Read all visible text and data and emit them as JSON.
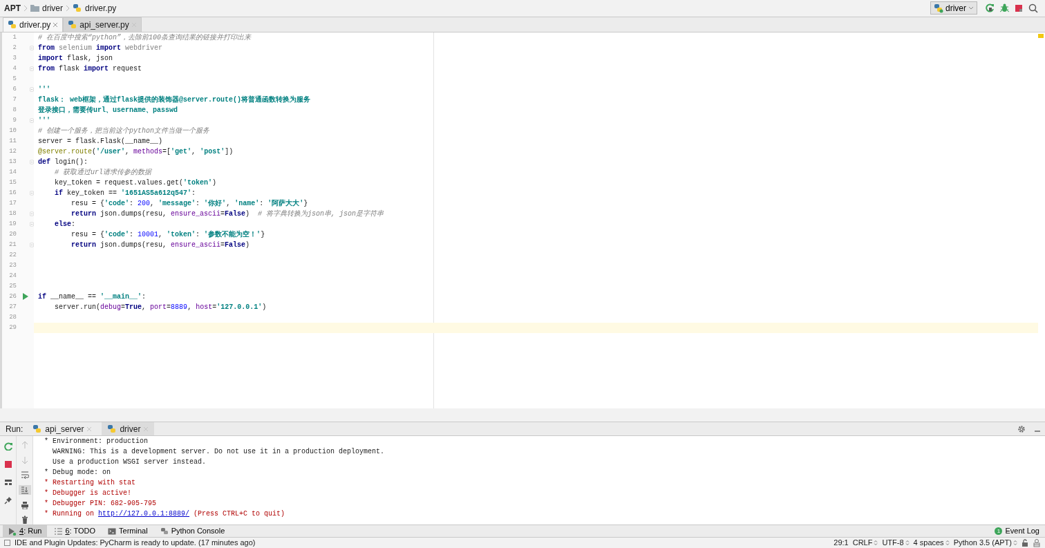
{
  "breadcrumb": [
    {
      "kind": "project",
      "label": "APT"
    },
    {
      "kind": "folder",
      "label": "driver"
    },
    {
      "kind": "file",
      "label": "driver.py"
    }
  ],
  "run_config": {
    "label": "driver"
  },
  "editor_tabs": [
    {
      "label": "driver.py",
      "selected": true
    },
    {
      "label": "api_server.py",
      "selected": false
    }
  ],
  "code_lines": [
    {
      "number": "1",
      "fold": false,
      "run": false,
      "current": false,
      "tokens": [
        {
          "kind": "comment",
          "text": "# 在百度中搜索“python”，去除前100条查询结果的链接并打印出来"
        }
      ]
    },
    {
      "number": "2",
      "fold": true,
      "run": false,
      "current": false,
      "tokens": [
        {
          "kind": "keyword",
          "text": "from"
        },
        {
          "kind": "unused",
          "text": " selenium "
        },
        {
          "kind": "keyword",
          "text": "import"
        },
        {
          "kind": "unused",
          "text": " webdriver"
        }
      ]
    },
    {
      "number": "3",
      "fold": false,
      "run": false,
      "current": false,
      "tokens": [
        {
          "kind": "keyword",
          "text": "import"
        },
        {
          "kind": "plain",
          "text": " flask, json"
        }
      ]
    },
    {
      "number": "4",
      "fold": true,
      "run": false,
      "current": false,
      "tokens": [
        {
          "kind": "keyword",
          "text": "from"
        },
        {
          "kind": "plain",
          "text": " flask "
        },
        {
          "kind": "keyword",
          "text": "import"
        },
        {
          "kind": "plain",
          "text": " request"
        }
      ]
    },
    {
      "number": "5",
      "fold": false,
      "run": false,
      "current": false
    },
    {
      "number": "6",
      "fold": true,
      "run": false,
      "current": false,
      "tokens": [
        {
          "kind": "doc",
          "text": "'''"
        }
      ]
    },
    {
      "number": "7",
      "fold": false,
      "run": false,
      "current": false,
      "tokens": [
        {
          "kind": "doc",
          "text": "flask： web框架，通过flask提供的装饰器@server.route()将普通函数转换为服务"
        }
      ]
    },
    {
      "number": "8",
      "fold": false,
      "run": false,
      "current": false,
      "tokens": [
        {
          "kind": "doc",
          "text": "登录接口，需要传url、username、passwd"
        }
      ]
    },
    {
      "number": "9",
      "fold": true,
      "run": false,
      "current": false,
      "tokens": [
        {
          "kind": "doc",
          "text": "'''"
        }
      ]
    },
    {
      "number": "10",
      "fold": false,
      "run": false,
      "current": false,
      "tokens": [
        {
          "kind": "comment",
          "text": "# 创建一个服务，把当前这个python文件当做一个服务"
        }
      ]
    },
    {
      "number": "11",
      "fold": false,
      "run": false,
      "current": false,
      "tokens": [
        {
          "kind": "plain",
          "text": "server = flask.Flask(__name__)"
        }
      ]
    },
    {
      "number": "12",
      "fold": false,
      "run": false,
      "current": false,
      "tokens": [
        {
          "kind": "decorator",
          "text": "@server.route"
        },
        {
          "kind": "plain",
          "text": "("
        },
        {
          "kind": "string",
          "text": "'/user'"
        },
        {
          "kind": "plain",
          "text": ", "
        },
        {
          "kind": "param",
          "text": "methods"
        },
        {
          "kind": "plain",
          "text": "=["
        },
        {
          "kind": "string",
          "text": "'get'"
        },
        {
          "kind": "plain",
          "text": ", "
        },
        {
          "kind": "string",
          "text": "'post'"
        },
        {
          "kind": "plain",
          "text": "])"
        }
      ]
    },
    {
      "number": "13",
      "fold": true,
      "run": false,
      "current": false,
      "tokens": [
        {
          "kind": "keyword",
          "text": "def"
        },
        {
          "kind": "plain",
          "text": " login():"
        }
      ]
    },
    {
      "number": "14",
      "fold": false,
      "run": false,
      "current": false,
      "tokens": [
        {
          "kind": "comment",
          "text": "    # 获取通过url请求传参的数据"
        }
      ]
    },
    {
      "number": "15",
      "fold": false,
      "run": false,
      "current": false,
      "tokens": [
        {
          "kind": "plain",
          "text": "    key_token = request.values.get("
        },
        {
          "kind": "string",
          "text": "'token'"
        },
        {
          "kind": "plain",
          "text": ")"
        }
      ]
    },
    {
      "number": "16",
      "fold": true,
      "run": false,
      "current": false,
      "tokens": [
        {
          "kind": "keyword",
          "text": "    if"
        },
        {
          "kind": "plain",
          "text": " key_token == "
        },
        {
          "kind": "string",
          "text": "'1651AS5a612q547'"
        },
        {
          "kind": "plain",
          "text": ":"
        }
      ]
    },
    {
      "number": "17",
      "fold": false,
      "run": false,
      "current": false,
      "tokens": [
        {
          "kind": "plain",
          "text": "        resu = {"
        },
        {
          "kind": "string",
          "text": "'code'"
        },
        {
          "kind": "plain",
          "text": ": "
        },
        {
          "kind": "number",
          "text": "200"
        },
        {
          "kind": "plain",
          "text": ", "
        },
        {
          "kind": "string",
          "text": "'message'"
        },
        {
          "kind": "plain",
          "text": ": "
        },
        {
          "kind": "string",
          "text": "'你好'"
        },
        {
          "kind": "plain",
          "text": ", "
        },
        {
          "kind": "string",
          "text": "'name'"
        },
        {
          "kind": "plain",
          "text": ": "
        },
        {
          "kind": "string",
          "text": "'阿萨大大'"
        },
        {
          "kind": "plain",
          "text": "}"
        }
      ]
    },
    {
      "number": "18",
      "fold": true,
      "run": false,
      "current": false,
      "tokens": [
        {
          "kind": "keyword",
          "text": "        return"
        },
        {
          "kind": "plain",
          "text": " json.dumps(resu, "
        },
        {
          "kind": "param",
          "text": "ensure_ascii"
        },
        {
          "kind": "plain",
          "text": "="
        },
        {
          "kind": "keyword",
          "text": "False"
        },
        {
          "kind": "plain",
          "text": ")  "
        },
        {
          "kind": "comment",
          "text": "# 将字典转换为json串, json是字符串"
        }
      ]
    },
    {
      "number": "19",
      "fold": true,
      "run": false,
      "current": false,
      "tokens": [
        {
          "kind": "keyword",
          "text": "    else"
        },
        {
          "kind": "plain",
          "text": ":"
        }
      ]
    },
    {
      "number": "20",
      "fold": false,
      "run": false,
      "current": false,
      "tokens": [
        {
          "kind": "plain",
          "text": "        resu = {"
        },
        {
          "kind": "string",
          "text": "'code'"
        },
        {
          "kind": "plain",
          "text": ": "
        },
        {
          "kind": "number",
          "text": "10001"
        },
        {
          "kind": "plain",
          "text": ", "
        },
        {
          "kind": "string",
          "text": "'token'"
        },
        {
          "kind": "plain",
          "text": ": "
        },
        {
          "kind": "string",
          "text": "'参数不能为空！'"
        },
        {
          "kind": "plain",
          "text": "}"
        }
      ]
    },
    {
      "number": "21",
      "fold": true,
      "run": false,
      "current": false,
      "tokens": [
        {
          "kind": "keyword",
          "text": "        return"
        },
        {
          "kind": "plain",
          "text": " json.dumps(resu, "
        },
        {
          "kind": "param",
          "text": "ensure_ascii"
        },
        {
          "kind": "plain",
          "text": "="
        },
        {
          "kind": "keyword",
          "text": "False"
        },
        {
          "kind": "plain",
          "text": ")"
        }
      ]
    },
    {
      "number": "22",
      "fold": false,
      "run": false,
      "current": false
    },
    {
      "number": "23",
      "fold": false,
      "run": false,
      "current": false
    },
    {
      "number": "24",
      "fold": false,
      "run": false,
      "current": false
    },
    {
      "number": "25",
      "fold": false,
      "run": false,
      "current": false
    },
    {
      "number": "26",
      "fold": false,
      "run": true,
      "current": false,
      "tokens": [
        {
          "kind": "keyword",
          "text": "if"
        },
        {
          "kind": "plain",
          "text": " __name__ == "
        },
        {
          "kind": "string",
          "text": "'__main__'"
        },
        {
          "kind": "plain",
          "text": ":"
        }
      ]
    },
    {
      "number": "27",
      "fold": false,
      "run": false,
      "current": false,
      "tokens": [
        {
          "kind": "plain",
          "text": "    server.run("
        },
        {
          "kind": "param",
          "text": "debug"
        },
        {
          "kind": "plain",
          "text": "="
        },
        {
          "kind": "keyword",
          "text": "True"
        },
        {
          "kind": "plain",
          "text": ", "
        },
        {
          "kind": "param",
          "text": "port"
        },
        {
          "kind": "plain",
          "text": "="
        },
        {
          "kind": "number",
          "text": "8889"
        },
        {
          "kind": "plain",
          "text": ", "
        },
        {
          "kind": "param",
          "text": "host"
        },
        {
          "kind": "plain",
          "text": "="
        },
        {
          "kind": "string",
          "text": "'127.0.0.1'"
        },
        {
          "kind": "plain",
          "text": ")"
        }
      ]
    },
    {
      "number": "28",
      "fold": false,
      "run": false,
      "current": false
    },
    {
      "number": "29",
      "fold": false,
      "run": false,
      "current": true
    }
  ],
  "run_panel": {
    "label": "Run:",
    "tabs": [
      {
        "label": "api_server",
        "selected": false
      },
      {
        "label": "driver",
        "selected": true
      }
    ],
    "toolbar": [
      {
        "kind": "rerun"
      },
      {
        "kind": "stop"
      },
      {
        "kind": "layout"
      },
      {
        "kind": "pin"
      }
    ],
    "console_toolbar": [
      {
        "kind": "up",
        "disabled": true,
        "selected": false
      },
      {
        "kind": "down",
        "disabled": true,
        "selected": false
      },
      {
        "kind": "wrap",
        "disabled": false,
        "selected": false
      },
      {
        "kind": "scroll",
        "disabled": false,
        "selected": true
      },
      {
        "kind": "print",
        "disabled": false,
        "selected": false
      },
      {
        "kind": "trash",
        "disabled": false,
        "selected": false
      }
    ],
    "console_lines": [
      {
        "kind": "out",
        "text": "* Environment: production"
      },
      {
        "kind": "out",
        "text": "  WARNING: This is a development server. Do not use it in a production deployment."
      },
      {
        "kind": "out",
        "text": "  Use a production WSGI server instead."
      },
      {
        "kind": "out",
        "text": "* Debug mode: on"
      },
      {
        "kind": "err",
        "text": "* Restarting with stat"
      },
      {
        "kind": "err",
        "text": "* Debugger is active!"
      },
      {
        "kind": "err",
        "text": "* Debugger PIN: 682-905-795"
      },
      {
        "kind": "err",
        "text": "* Running on ",
        "link": "http://127.0.0.1:8889/",
        "after": " (Press CTRL+C to quit)"
      }
    ]
  },
  "tool_windows": [
    {
      "kind": "run",
      "mnemonic": "4",
      "label": ": Run",
      "selected": true
    },
    {
      "kind": "todo",
      "mnemonic": "6",
      "label": ": TODO",
      "selected": false
    },
    {
      "kind": "terminal",
      "label": "Terminal",
      "selected": false
    },
    {
      "kind": "console",
      "label": "Python Console",
      "selected": false
    }
  ],
  "event_log": {
    "label": "Event Log",
    "count": "1"
  },
  "status_bar": {
    "message": "IDE and Plugin Updates: PyCharm is ready to update. (17 minutes ago)",
    "items": [
      {
        "text": "29:1",
        "menu": false
      },
      {
        "text": "CRLF",
        "menu": true
      },
      {
        "text": "UTF-8",
        "menu": true
      },
      {
        "text": "4 spaces",
        "menu": true
      },
      {
        "text": "Python 3.5 (APT)",
        "menu": true
      }
    ]
  }
}
